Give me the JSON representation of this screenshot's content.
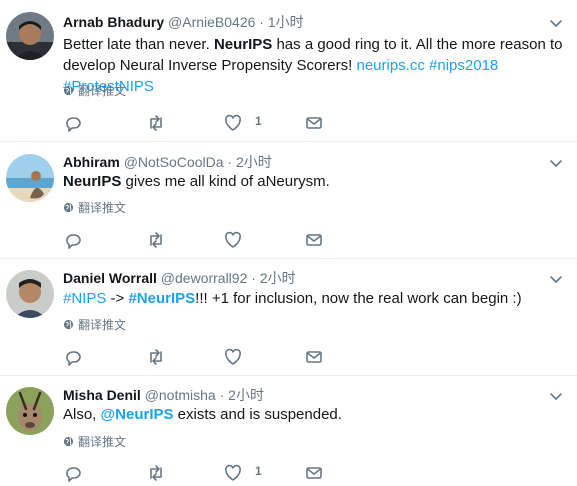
{
  "tweets": [
    {
      "name": "Arnab Bhadury",
      "handle": "@ArnieB0426",
      "time": "1小时",
      "translate": "翻译推文",
      "like_count": "1",
      "text": {
        "p1": "Better late than never. ",
        "p2": "NeurIPS",
        "p3": " has a good ring to it. All the more reason to develop Neural Inverse Propensity Scorers! ",
        "p4": "neurips.cc",
        "p5": "  ",
        "p6": "#nips2018",
        "p7": " ",
        "p8": "#ProtestNIPS"
      }
    },
    {
      "name": "Abhiram",
      "handle": "@NotSoCoolDa",
      "time": "2小时",
      "translate": "翻译推文",
      "like_count": "",
      "text": {
        "p1": "NeurIPS",
        "p2": " gives me all kind of aNeurysm."
      }
    },
    {
      "name": "Daniel Worrall",
      "handle": "@deworrall92",
      "time": "2小时",
      "translate": "翻译推文",
      "like_count": "",
      "text": {
        "p1": "#NIPS",
        "p2": " -> ",
        "p3": "#NeurIPS",
        "p4": "!!! +1 for inclusion, now the real work can begin :)"
      }
    },
    {
      "name": "Misha Denil",
      "handle": "@notmisha",
      "time": "2小时",
      "translate": "翻译推文",
      "like_count": "1",
      "text": {
        "p1": "Also, ",
        "p2": "@NeurIPS",
        "p3": " exists and is suspended."
      }
    }
  ],
  "separator": "·",
  "colors": {
    "link": "#1da1f2",
    "muted": "#657786",
    "text": "#14171a",
    "divider": "#e6ecf0"
  },
  "icons": [
    "chevron-down-icon",
    "globe-icon",
    "reply-icon",
    "retweet-icon",
    "like-icon",
    "message-icon"
  ]
}
